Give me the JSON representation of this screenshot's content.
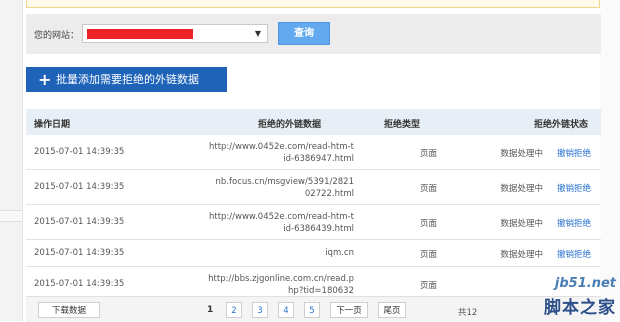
{
  "query": {
    "label": "您的网站：",
    "button": "查询"
  },
  "batch": {
    "label": "批量添加需要拒绝的外链数据"
  },
  "table": {
    "headers": [
      "操作日期",
      "拒绝的外链数据",
      "拒绝类型",
      "拒绝外链状态"
    ],
    "rows": [
      {
        "date": "2015-07-01 14:39:35",
        "link1": "http://www.0452e.com/read-htm-t",
        "link2": "id-6386947.html",
        "type": "页面",
        "status": "数据处理中",
        "action": "撤销拒绝"
      },
      {
        "date": "2015-07-01 14:39:35",
        "link1": "nb.focus.cn/msgview/5391/2821",
        "link2": "02722.html",
        "type": "页面",
        "status": "数据处理中",
        "action": "撤销拒绝"
      },
      {
        "date": "2015-07-01 14:39:35",
        "link1": "http://www.0452e.com/read-htm-t",
        "link2": "id-6386439.html",
        "type": "页面",
        "status": "数据处理中",
        "action": "撤销拒绝"
      },
      {
        "date": "2015-07-01 14:39:35",
        "link1": "iqm.cn",
        "link2": "",
        "type": "页面",
        "status": "数据处理中",
        "action": "撤销拒绝"
      },
      {
        "date": "2015-07-01 14:39:35",
        "link1": "http://bbs.zjgonline.com.cn/read.p",
        "link2": "hp?tid=180632",
        "type": "页面",
        "status": "",
        "action": ""
      }
    ]
  },
  "pager": {
    "download": "下载数据",
    "pages": [
      "1",
      "2",
      "3",
      "4",
      "5"
    ],
    "next": "下一页",
    "last": "尾页",
    "total": "共12"
  },
  "watermark": {
    "site": "jb51.net",
    "name": "脚本之家"
  }
}
